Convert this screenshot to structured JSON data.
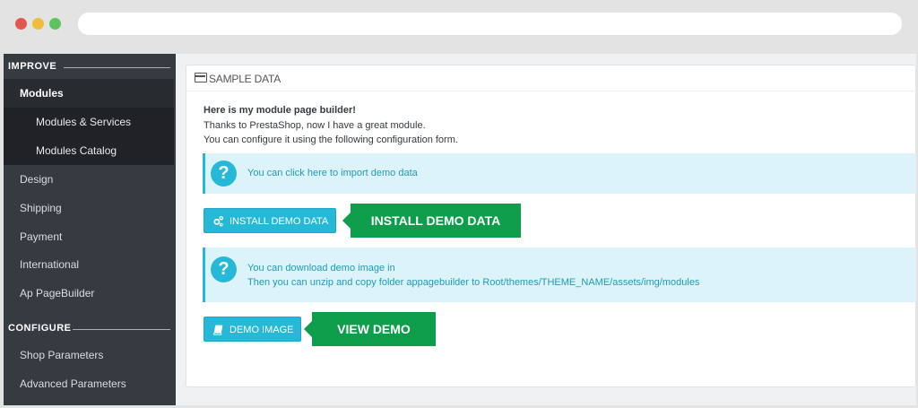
{
  "sidebar": {
    "improve_label": "IMPROVE",
    "items": [
      {
        "label": "Modules"
      },
      {
        "label": "Modules & Services"
      },
      {
        "label": "Modules Catalog"
      },
      {
        "label": "Design"
      },
      {
        "label": "Shipping"
      },
      {
        "label": "Payment"
      },
      {
        "label": "International"
      },
      {
        "label": "Ap PageBuilder"
      }
    ],
    "configure_label": "CONFIGURE",
    "config_items": [
      {
        "label": "Shop Parameters"
      },
      {
        "label": "Advanced Parameters"
      }
    ]
  },
  "panel": {
    "title": "SAMPLE DATA",
    "intro_heading": "Here is my module page builder!",
    "intro_line1": "Thanks to PrestaShop, now I have a great module.",
    "intro_line2": "You can configure it using the following configuration form.",
    "alert1": "You can click here to import demo data",
    "install_button": "INSTALL DEMO DATA",
    "install_callout": "INSTALL DEMO DATA",
    "alert2_line1": "You can download demo image in",
    "alert2_line2": "Then you can unzip and copy folder appagebuilder to Root/themes/THEME_NAME/assets/img/modules",
    "demo_button": "DEMO IMAGE",
    "demo_callout": "VIEW DEMO"
  },
  "colors": {
    "sidebar_bg": "#363a41",
    "accent": "#25b9d7",
    "callout_green": "#0e9e4b",
    "alert_bg": "#dcf4f9"
  }
}
